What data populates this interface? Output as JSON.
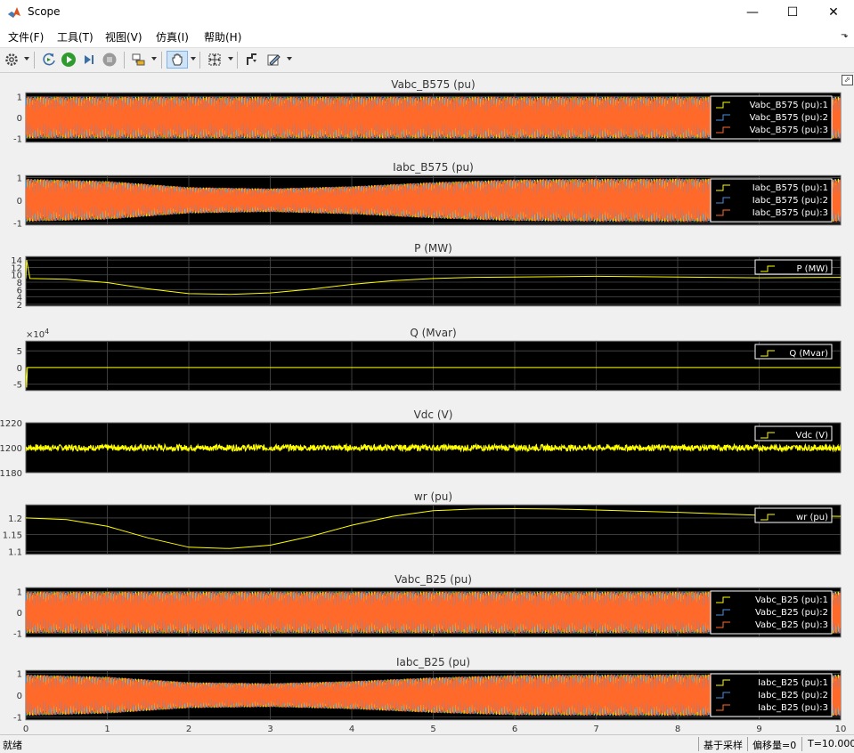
{
  "window": {
    "title": "Scope",
    "minimize": "—",
    "maximize": "☐",
    "close": "✕"
  },
  "menu": [
    "文件(F)",
    "工具(T)",
    "视图(V)",
    "仿真(I)",
    "帮助(H)"
  ],
  "toolbar_icons": [
    "settings-icon",
    "step-back-icon",
    "run-icon",
    "step-forward-icon",
    "stop-icon",
    "highlight-block-icon",
    "pan-icon",
    "zoom-fit-icon",
    "triggers-icon",
    "style-icon"
  ],
  "colors": {
    "axes_bg": "#000000",
    "grid": "#4d4d4d",
    "trace1": "#ffff00",
    "trace2": "#4a90e2",
    "trace3": "#ff6a2a",
    "text": "#333333"
  },
  "status": {
    "ready": "就绪",
    "sample_based": "基于采样",
    "offset": "偏移量=0",
    "time": "T=10.000"
  },
  "chart_data": [
    {
      "type": "line",
      "title": "Vabc_B575 (pu)",
      "ylim": [
        -1.2,
        1.2
      ],
      "yticks": [
        "1",
        "0",
        "-1"
      ],
      "ytick_values": [
        1,
        0,
        -1
      ],
      "xlim": [
        0,
        10
      ],
      "legend": [
        "Vabc_B575 (pu):1",
        "Vabc_B575 (pu):2",
        "Vabc_B575 (pu):3"
      ],
      "series": [
        {
          "name": "Vabc_B575 (pu):1",
          "kind": "ac",
          "x": [
            0,
            10
          ],
          "amplitude": [
            1.0,
            1.0
          ]
        },
        {
          "name": "Vabc_B575 (pu):2",
          "kind": "ac",
          "x": [
            0,
            10
          ],
          "amplitude": [
            1.0,
            1.0
          ]
        },
        {
          "name": "Vabc_B575 (pu):3",
          "kind": "ac",
          "x": [
            0,
            10
          ],
          "amplitude": [
            1.0,
            1.0
          ]
        }
      ]
    },
    {
      "type": "line",
      "title": "Iabc_B575 (pu)",
      "ylim": [
        -1.1,
        1.1
      ],
      "yticks": [
        "1",
        "0",
        "-1"
      ],
      "ytick_values": [
        1,
        0,
        -1
      ],
      "xlim": [
        0,
        10
      ],
      "legend": [
        "Iabc_B575 (pu):1",
        "Iabc_B575 (pu):2",
        "Iabc_B575 (pu):3"
      ],
      "series": [
        {
          "name": "Iabc_B575 (pu):1",
          "kind": "ac",
          "x": [
            0,
            1,
            2,
            3,
            4,
            5,
            6,
            7,
            8,
            9,
            10
          ],
          "amplitude": [
            0.95,
            0.85,
            0.58,
            0.52,
            0.62,
            0.8,
            0.92,
            0.95,
            0.96,
            0.95,
            0.95
          ]
        },
        {
          "name": "Iabc_B575 (pu):2",
          "kind": "ac",
          "x": [
            0,
            1,
            2,
            3,
            4,
            5,
            6,
            7,
            8,
            9,
            10
          ],
          "amplitude": [
            0.95,
            0.85,
            0.58,
            0.52,
            0.62,
            0.8,
            0.92,
            0.95,
            0.96,
            0.95,
            0.95
          ]
        },
        {
          "name": "Iabc_B575 (pu):3",
          "kind": "ac",
          "x": [
            0,
            1,
            2,
            3,
            4,
            5,
            6,
            7,
            8,
            9,
            10
          ],
          "amplitude": [
            0.95,
            0.85,
            0.58,
            0.52,
            0.62,
            0.8,
            0.92,
            0.95,
            0.96,
            0.95,
            0.95
          ]
        }
      ]
    },
    {
      "type": "line",
      "title": "P (MW)",
      "ylim": [
        1.5,
        15
      ],
      "yticks": [
        "14",
        "12",
        "10",
        "8",
        "6",
        "4",
        "2"
      ],
      "ytick_values": [
        14,
        12,
        10,
        8,
        6,
        4,
        2
      ],
      "xlim": [
        0,
        10
      ],
      "legend": [
        "P (MW)"
      ],
      "series": [
        {
          "name": "P (MW)",
          "kind": "line",
          "x": [
            0,
            0.01,
            0.05,
            0.5,
            1,
            1.5,
            2,
            2.5,
            3,
            3.5,
            4,
            4.5,
            5,
            5.5,
            6,
            7,
            8,
            9,
            10
          ],
          "y": [
            9,
            14,
            9,
            8.8,
            7.9,
            6.2,
            4.9,
            4.7,
            5.1,
            6.1,
            7.4,
            8.4,
            9.0,
            9.3,
            9.4,
            9.6,
            9.4,
            9.2,
            9.3
          ]
        }
      ]
    },
    {
      "type": "line",
      "title": "Q (Mvar)",
      "multiplier": "×10",
      "multiplier_exp": "4",
      "ylim": [
        -7,
        8
      ],
      "yticks": [
        "5",
        "0",
        "-5"
      ],
      "ytick_values": [
        5,
        0,
        -5
      ],
      "xlim": [
        0,
        10
      ],
      "legend": [
        "Q (Mvar)"
      ],
      "series": [
        {
          "name": "Q (Mvar)",
          "kind": "line",
          "x": [
            0,
            0.01,
            0.02,
            0.04,
            10
          ],
          "y": [
            0,
            -6,
            0,
            0,
            0
          ]
        }
      ]
    },
    {
      "type": "line",
      "title": "Vdc (V)",
      "ylim": [
        1180,
        1220
      ],
      "yticks": [
        "1220",
        "1200",
        "1180"
      ],
      "ytick_values": [
        1220,
        1200,
        1180
      ],
      "xlim": [
        0,
        10
      ],
      "legend": [
        "Vdc (V)"
      ],
      "series": [
        {
          "name": "Vdc (V)",
          "kind": "noise",
          "x": [
            0,
            10
          ],
          "y": [
            1200,
            1200
          ],
          "noise": 2.5
        }
      ]
    },
    {
      "type": "line",
      "title": "wr (pu)",
      "ylim": [
        1.09,
        1.24
      ],
      "yticks": [
        "1.2",
        "1.15",
        "1.1"
      ],
      "ytick_values": [
        1.2,
        1.15,
        1.1
      ],
      "xlim": [
        0,
        10
      ],
      "legend": [
        "wr (pu)"
      ],
      "series": [
        {
          "name": "wr (pu)",
          "kind": "line",
          "x": [
            0,
            0.5,
            1,
            1.5,
            2,
            2.5,
            3,
            3.5,
            4,
            4.5,
            5,
            5.5,
            6,
            6.5,
            7,
            8,
            9,
            10
          ],
          "y": [
            1.2,
            1.195,
            1.175,
            1.14,
            1.112,
            1.108,
            1.118,
            1.145,
            1.178,
            1.205,
            1.222,
            1.227,
            1.228,
            1.227,
            1.224,
            1.217,
            1.208,
            1.205
          ]
        }
      ]
    },
    {
      "type": "line",
      "title": "Vabc_B25 (pu)",
      "ylim": [
        -1.2,
        1.2
      ],
      "yticks": [
        "1",
        "0",
        "-1"
      ],
      "ytick_values": [
        1,
        0,
        -1
      ],
      "xlim": [
        0,
        10
      ],
      "legend": [
        "Vabc_B25 (pu):1",
        "Vabc_B25 (pu):2",
        "Vabc_B25 (pu):3"
      ],
      "series": [
        {
          "name": "Vabc_B25 (pu):1",
          "kind": "ac",
          "x": [
            0,
            10
          ],
          "amplitude": [
            1.0,
            1.0
          ]
        },
        {
          "name": "Vabc_B25 (pu):2",
          "kind": "ac",
          "x": [
            0,
            10
          ],
          "amplitude": [
            1.0,
            1.0
          ]
        },
        {
          "name": "Vabc_B25 (pu):3",
          "kind": "ac",
          "x": [
            0,
            10
          ],
          "amplitude": [
            1.0,
            1.0
          ]
        }
      ]
    },
    {
      "type": "line",
      "title": "Iabc_B25 (pu)",
      "ylim": [
        -1.15,
        1.15
      ],
      "yticks": [
        "1",
        "0",
        "-1"
      ],
      "ytick_values": [
        1,
        0,
        -1
      ],
      "xlim": [
        0,
        10
      ],
      "xticks": [
        "0",
        "1",
        "2",
        "3",
        "4",
        "5",
        "6",
        "7",
        "8",
        "9",
        "10"
      ],
      "xtick_values": [
        0,
        1,
        2,
        3,
        4,
        5,
        6,
        7,
        8,
        9,
        10
      ],
      "legend": [
        "Iabc_B25 (pu):1",
        "Iabc_B25 (pu):2",
        "Iabc_B25 (pu):3"
      ],
      "series": [
        {
          "name": "Iabc_B25 (pu):1",
          "kind": "ac",
          "x": [
            0,
            1,
            2,
            3,
            4,
            5,
            6,
            7,
            8,
            9,
            10
          ],
          "amplitude": [
            0.95,
            0.85,
            0.6,
            0.55,
            0.65,
            0.82,
            0.93,
            0.95,
            0.96,
            0.95,
            0.95
          ]
        },
        {
          "name": "Iabc_B25 (pu):2",
          "kind": "ac",
          "x": [
            0,
            1,
            2,
            3,
            4,
            5,
            6,
            7,
            8,
            9,
            10
          ],
          "amplitude": [
            0.95,
            0.85,
            0.6,
            0.55,
            0.65,
            0.82,
            0.93,
            0.95,
            0.96,
            0.95,
            0.95
          ]
        },
        {
          "name": "Iabc_B25 (pu):3",
          "kind": "ac",
          "x": [
            0,
            1,
            2,
            3,
            4,
            5,
            6,
            7,
            8,
            9,
            10
          ],
          "amplitude": [
            0.95,
            0.85,
            0.6,
            0.55,
            0.65,
            0.82,
            0.93,
            0.95,
            0.96,
            0.95,
            0.95
          ]
        }
      ]
    }
  ]
}
